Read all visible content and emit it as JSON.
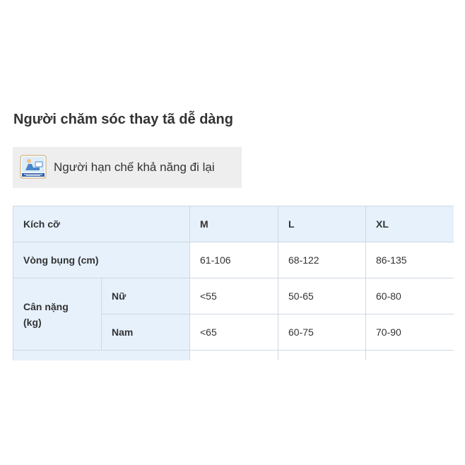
{
  "heading": "Người chăm sóc thay tã dễ dàng",
  "tag": {
    "label": "Người hạn chế khả năng đi lại",
    "icon": "mobility-limited-badge-icon"
  },
  "table": {
    "header": {
      "label": "Kích cỡ",
      "sizes": [
        "M",
        "L",
        "XL"
      ]
    },
    "waist": {
      "label": "Vòng bụng (cm)",
      "values": [
        "61-106",
        "68-122",
        "86-135"
      ]
    },
    "weight": {
      "label_line1": "Cân nặng",
      "label_line2": "(kg)",
      "female": {
        "label": "Nữ",
        "values": [
          "<55",
          "50-65",
          "60-80"
        ]
      },
      "male": {
        "label": "Nam",
        "values": [
          "<65",
          "60-75",
          "70-90"
        ]
      }
    }
  },
  "colors": {
    "header_bg": "#e6f1fc",
    "tag_bg": "#eeeeee",
    "border": "#cfd8e3",
    "text": "#333333"
  }
}
